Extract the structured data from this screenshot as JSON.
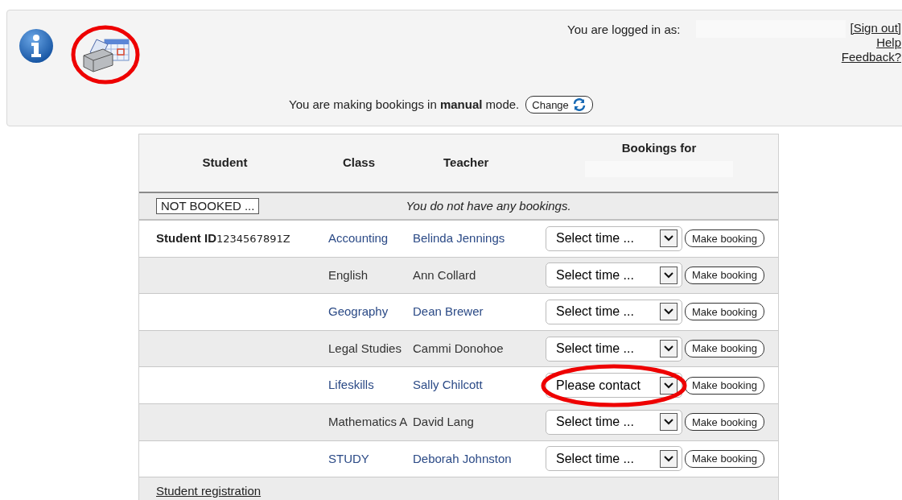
{
  "header": {
    "icon_highlighted": true,
    "logged_in_label": "You are logged in as:",
    "links": [
      "[Sign out]",
      "Help",
      "Feedback?"
    ],
    "mode_text": "You are making bookings in **manual** mode.",
    "change_button": "Change"
  },
  "table": {
    "columns": [
      "Student",
      "Class",
      "Teacher",
      "Bookings for"
    ],
    "status": {
      "badge": "NOT BOOKED ...",
      "message": "You do not have any bookings."
    },
    "student_label": "Student ID",
    "student_id": "1234567891Z",
    "rows": [
      {
        "class": "Accounting",
        "teacher": "Belinda Jennings",
        "linked": true,
        "select": "Select time ...",
        "highlighted": false,
        "button": "Make booking"
      },
      {
        "class": "English",
        "teacher": "Ann Collard",
        "linked": false,
        "select": "Select time ...",
        "highlighted": false,
        "button": "Make booking"
      },
      {
        "class": "Geography",
        "teacher": "Dean Brewer",
        "linked": true,
        "select": "Select time ...",
        "highlighted": false,
        "button": "Make booking"
      },
      {
        "class": "Legal Studies",
        "teacher": "Cammi Donohoe",
        "linked": false,
        "select": "Select time ...",
        "highlighted": false,
        "button": "Make booking"
      },
      {
        "class": "Lifeskills",
        "teacher": "Sally Chilcott",
        "linked": true,
        "select": "Please contact",
        "highlighted": true,
        "button": "Make booking"
      },
      {
        "class": "Mathematics A",
        "teacher": "David Lang",
        "linked": false,
        "select": "Select time ...",
        "highlighted": false,
        "button": "Make booking"
      },
      {
        "class": "STUDY",
        "teacher": "Deborah Johnston",
        "linked": true,
        "select": "Select time ...",
        "highlighted": false,
        "button": "Make booking"
      }
    ],
    "footer_link": "Student registration"
  }
}
